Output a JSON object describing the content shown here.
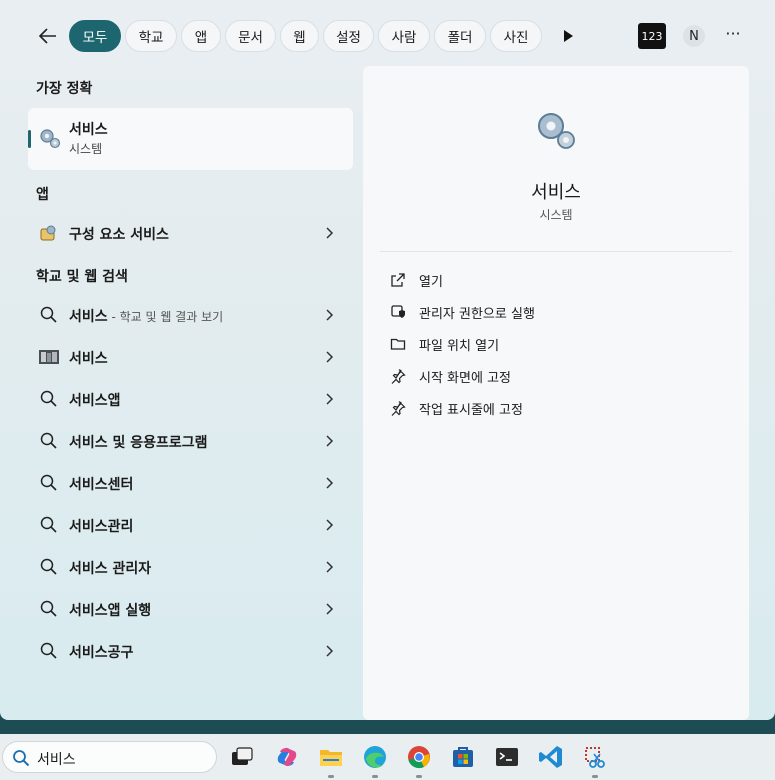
{
  "filters": {
    "tabs": [
      "모두",
      "학교",
      "앱",
      "문서",
      "웹",
      "설정",
      "사람",
      "폴더",
      "사진"
    ],
    "badge": "123",
    "avatar": "N",
    "more": "···"
  },
  "left": {
    "best_match_title": "가장 정확",
    "best": {
      "name": "서비스",
      "type": "시스템"
    },
    "apps_title": "앱",
    "apps": [
      {
        "label": "구성 요소 서비스"
      }
    ],
    "web_title": "학교 및 웹 검색",
    "web": [
      {
        "label": "서비스",
        "sub": " - 학교 및 웹 결과 보기"
      },
      {
        "label": "서비스"
      },
      {
        "label": "서비스앱"
      },
      {
        "label": "서비스 및 응용프로그램"
      },
      {
        "label": "서비스센터"
      },
      {
        "label": "서비스관리"
      },
      {
        "label": "서비스 관리자"
      },
      {
        "label": "서비스앱 실행"
      },
      {
        "label": "서비스공구"
      }
    ]
  },
  "preview": {
    "title": "서비스",
    "subtitle": "시스템",
    "actions": [
      "열기",
      "관리자 권한으로 실행",
      "파일 위치 열기",
      "시작 화면에 고정",
      "작업 표시줄에 고정"
    ]
  },
  "taskbar": {
    "search_value": "서비스",
    "apps": [
      "task-view-icon",
      "copilot-icon",
      "file-explorer-icon",
      "edge-icon",
      "chrome-icon",
      "store-icon",
      "terminal-icon",
      "vscode-icon",
      "snipping-tool-icon"
    ]
  },
  "colors": {
    "accent": "#1d6670"
  }
}
